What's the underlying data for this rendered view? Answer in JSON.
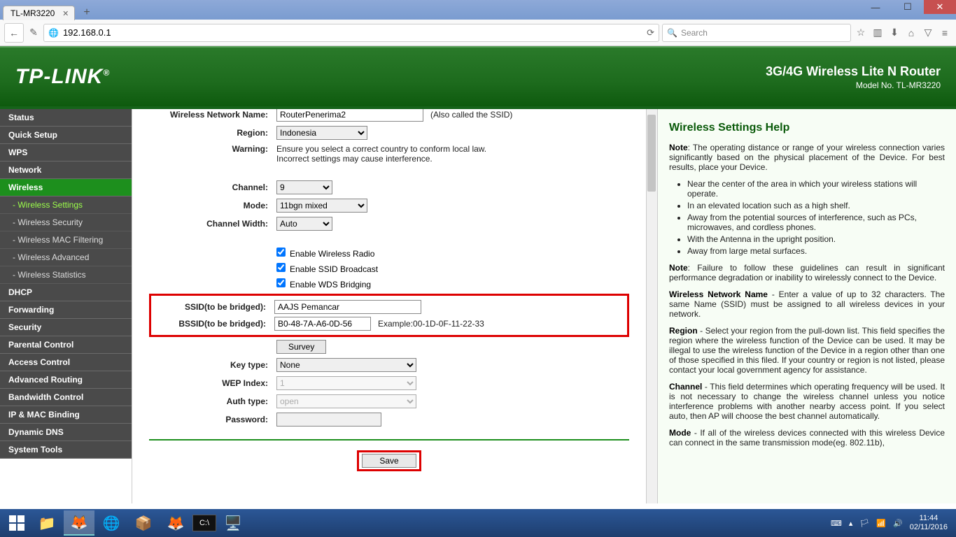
{
  "window": {
    "tab_title": "TL-MR3220"
  },
  "browser": {
    "url": "192.168.0.1",
    "search_placeholder": "Search"
  },
  "banner": {
    "brand": "TP-LINK",
    "product": "3G/4G Wireless Lite N Router",
    "model": "Model No. TL-MR3220"
  },
  "sidebar": {
    "items": [
      {
        "label": "Status"
      },
      {
        "label": "Quick Setup"
      },
      {
        "label": "WPS"
      },
      {
        "label": "Network"
      },
      {
        "label": "Wireless"
      },
      {
        "label": "DHCP"
      },
      {
        "label": "Forwarding"
      },
      {
        "label": "Security"
      },
      {
        "label": "Parental Control"
      },
      {
        "label": "Access Control"
      },
      {
        "label": "Advanced Routing"
      },
      {
        "label": "Bandwidth Control"
      },
      {
        "label": "IP & MAC Binding"
      },
      {
        "label": "Dynamic DNS"
      },
      {
        "label": "System Tools"
      }
    ],
    "subs": [
      {
        "label": "- Wireless Settings"
      },
      {
        "label": "- Wireless Security"
      },
      {
        "label": "- Wireless MAC Filtering"
      },
      {
        "label": "- Wireless Advanced"
      },
      {
        "label": "- Wireless Statistics"
      }
    ]
  },
  "form": {
    "wname_label": "Wireless Network Name:",
    "wname_value": "RouterPenerima2",
    "wname_hint": "(Also called the SSID)",
    "region_label": "Region:",
    "region_value": "Indonesia",
    "warning_label": "Warning:",
    "warning_text1": "Ensure you select a correct country to conform local law.",
    "warning_text2": "Incorrect settings may cause interference.",
    "channel_label": "Channel:",
    "channel_value": "9",
    "mode_label": "Mode:",
    "mode_value": "11bgn mixed",
    "chwidth_label": "Channel Width:",
    "chwidth_value": "Auto",
    "enable_radio": "Enable Wireless Radio",
    "enable_ssid": "Enable SSID Broadcast",
    "enable_wds": "Enable WDS Bridging",
    "ssid_bridge_label": "SSID(to be bridged):",
    "ssid_bridge_value": "AAJS Pemancar",
    "bssid_bridge_label": "BSSID(to be bridged):",
    "bssid_bridge_value": "B0-48-7A-A6-0D-56",
    "bssid_example": "Example:00-1D-0F-11-22-33",
    "survey": "Survey",
    "keytype_label": "Key type:",
    "keytype_value": "None",
    "wepindex_label": "WEP Index:",
    "wepindex_value": "1",
    "authtype_label": "Auth type:",
    "authtype_value": "open",
    "password_label": "Password:",
    "save": "Save"
  },
  "help": {
    "title": "Wireless Settings Help",
    "note1_b": "Note",
    "note1": ": The operating distance or range of your wireless connection varies significantly based on the physical placement of the Device. For best results, place your Device.",
    "bul1": "Near the center of the area in which your wireless stations will operate.",
    "bul2": "In an elevated location such as a high shelf.",
    "bul3": "Away from the potential sources of interference, such as PCs, microwaves, and cordless phones.",
    "bul4": "With the Antenna in the upright position.",
    "bul5": "Away from large metal surfaces.",
    "note2_b": "Note",
    "note2": ": Failure to follow these guidelines can result in significant performance degradation or inability to wirelessly connect to the Device.",
    "wn_b": "Wireless Network Name",
    "wn": " - Enter a value of up to 32 characters. The same Name (SSID) must be assigned to all wireless devices in your network.",
    "rg_b": "Region",
    "rg": " - Select your region from the pull-down list. This field specifies the region where the wireless function of the Device can be used. It may be illegal to use the wireless function of the Device in a region other than one of those specified in this filed. If your country or region is not listed, please contact your local government agency for assistance.",
    "ch_b": "Channel",
    "ch": " - This field determines which operating frequency will be used. It is not necessary to change the wireless channel unless you notice interference problems with another nearby access point. If you select auto, then AP will choose the best channel automatically.",
    "md_b": "Mode",
    "md": " - If all of the wireless devices connected with this wireless Device can connect in the same transmission mode(eg. 802.11b),"
  },
  "tray": {
    "time": "11:44",
    "date": "02/11/2016"
  }
}
